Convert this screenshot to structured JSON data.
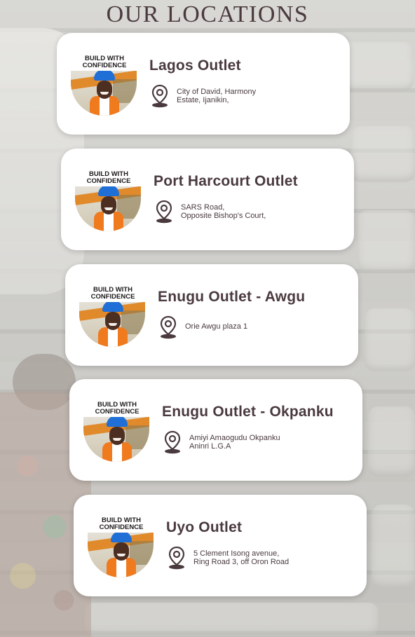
{
  "page": {
    "title": "OUR LOCATIONS"
  },
  "locations": [
    {
      "badge_line1": "BUILD WITH",
      "badge_line2": "CONFIDENCE",
      "name": "Lagos Outlet",
      "address_line1": "City of David, Harmony",
      "address_line2": "Estate, Ijanikin,",
      "icon": "map-pin-icon"
    },
    {
      "badge_line1": "BUILD WITH",
      "badge_line2": "CONFIDENCE",
      "name": "Port Harcourt Outlet",
      "address_line1": "SARS Road,",
      "address_line2": "Opposite Bishop's Court,",
      "icon": "map-pin-icon"
    },
    {
      "badge_line1": "BUILD WITH",
      "badge_line2": "CONFIDENCE",
      "name": "Enugu Outlet - Awgu",
      "address_line1": "Orie Awgu plaza 1",
      "address_line2": "",
      "icon": "map-pin-icon"
    },
    {
      "badge_line1": "BUILD WITH",
      "badge_line2": "CONFIDENCE",
      "name": "Enugu Outlet - Okpanku",
      "address_line1": "Amiyi Amaogudu Okpanku",
      "address_line2": "Aninri L.G.A",
      "icon": "map-pin-icon"
    },
    {
      "badge_line1": "BUILD WITH",
      "badge_line2": "CONFIDENCE",
      "name": "Uyo Outlet",
      "address_line1": "5 Clement Isong avenue,",
      "address_line2": "Ring Road 3, off Oron Road",
      "icon": "map-pin-icon"
    }
  ],
  "colors": {
    "title": "#4a3a3e",
    "card": "#ffffff",
    "vest": "#f07a1e",
    "helmet": "#1f6fd6"
  }
}
